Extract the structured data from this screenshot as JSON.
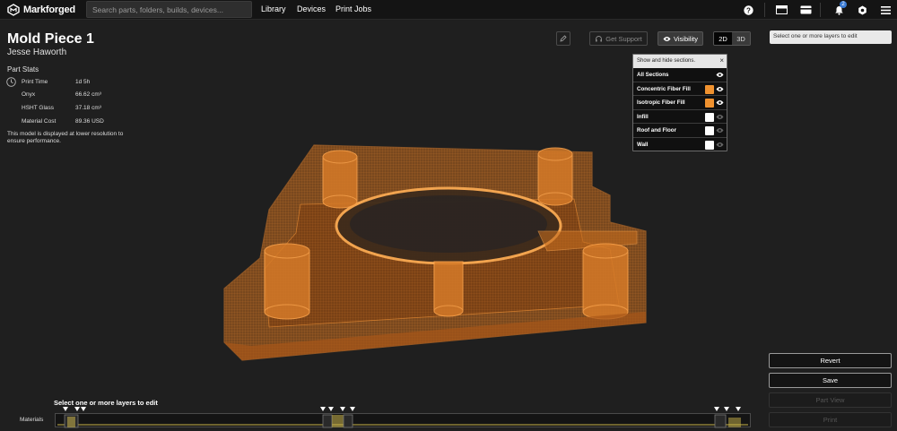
{
  "app": {
    "brand": "Markforged"
  },
  "topbar": {
    "search_placeholder": "Search parts, folders, builds, devices...",
    "nav": [
      "Library",
      "Devices",
      "Print Jobs"
    ],
    "notification_count": "2"
  },
  "part": {
    "title": "Mold Piece 1",
    "owner": "Jesse Haworth"
  },
  "stats": {
    "heading": "Part Stats",
    "rows": [
      {
        "label": "Print Time",
        "value": "1d 5h"
      },
      {
        "label": "Onyx",
        "value": "66.62 cm³"
      },
      {
        "label": "HSHT Glass",
        "value": "37.18 cm³"
      },
      {
        "label": "Material Cost",
        "value": "89.36 USD"
      }
    ],
    "note": "This model is displayed at lower resolution to ensure performance."
  },
  "toolbar": {
    "support_label": "Get Support",
    "visibility_label": "Visibility",
    "view_2d": "2D",
    "view_3d": "3D",
    "active_view": "2D"
  },
  "layers_hint": "Select one or more layers to edit",
  "visibility_popover": {
    "header": "Show and hide sections.",
    "items": [
      {
        "label": "All Sections",
        "color": null,
        "visible": true
      },
      {
        "label": "Concentric Fiber Fill",
        "color": "#f0922f",
        "visible": true
      },
      {
        "label": "Isotropic Fiber Fill",
        "color": "#f0922f",
        "visible": true
      },
      {
        "label": "Infill",
        "color": "#ffffff",
        "visible": false
      },
      {
        "label": "Roof and Floor",
        "color": "#ffffff",
        "visible": false
      },
      {
        "label": "Wall",
        "color": "#ffffff",
        "visible": false
      }
    ]
  },
  "actions": {
    "revert": "Revert",
    "save": "Save",
    "part_view": "Part View",
    "print": "Print"
  },
  "bottom": {
    "select_label": "Select one or more layers to edit",
    "materials_label": "Materials"
  },
  "colors": {
    "accent": "#f0922f",
    "fiber_track": "#c9b34a",
    "badge": "#3a7bd5"
  }
}
